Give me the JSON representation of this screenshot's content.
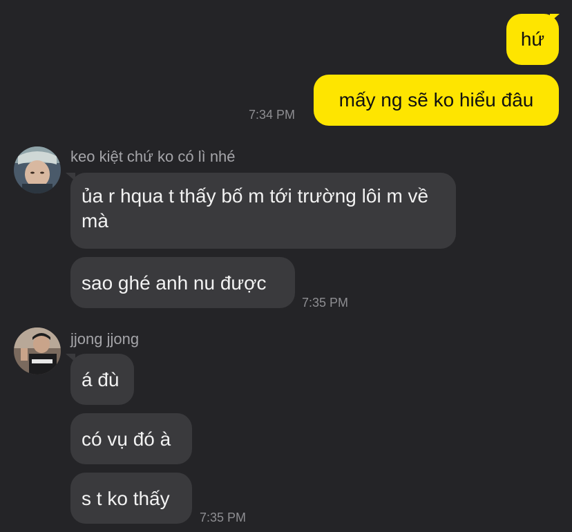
{
  "outgoing": [
    {
      "text": "hứ"
    },
    {
      "text": "mấy ng sẽ ko hiểu đâu",
      "time": "7:34 PM"
    }
  ],
  "groups": [
    {
      "sender": "keo kiệt chứ ko có lì nhé",
      "avatar_icon": "profile-photo-icon",
      "messages": [
        {
          "text": "ủa r hqua t thấy bố m tới trường lôi m về mà"
        },
        {
          "text": "sao ghé anh nu được",
          "time": "7:35 PM"
        }
      ]
    },
    {
      "sender": "jjong jjong",
      "avatar_icon": "profile-photo-icon",
      "messages": [
        {
          "text": "á đù"
        },
        {
          "text": "có vụ đó à"
        },
        {
          "text": "s t ko thấy",
          "time": "7:35 PM"
        }
      ]
    }
  ],
  "colors": {
    "background": "#242427",
    "outgoing_bubble": "#FEE500",
    "incoming_bubble": "#3A3A3D"
  }
}
